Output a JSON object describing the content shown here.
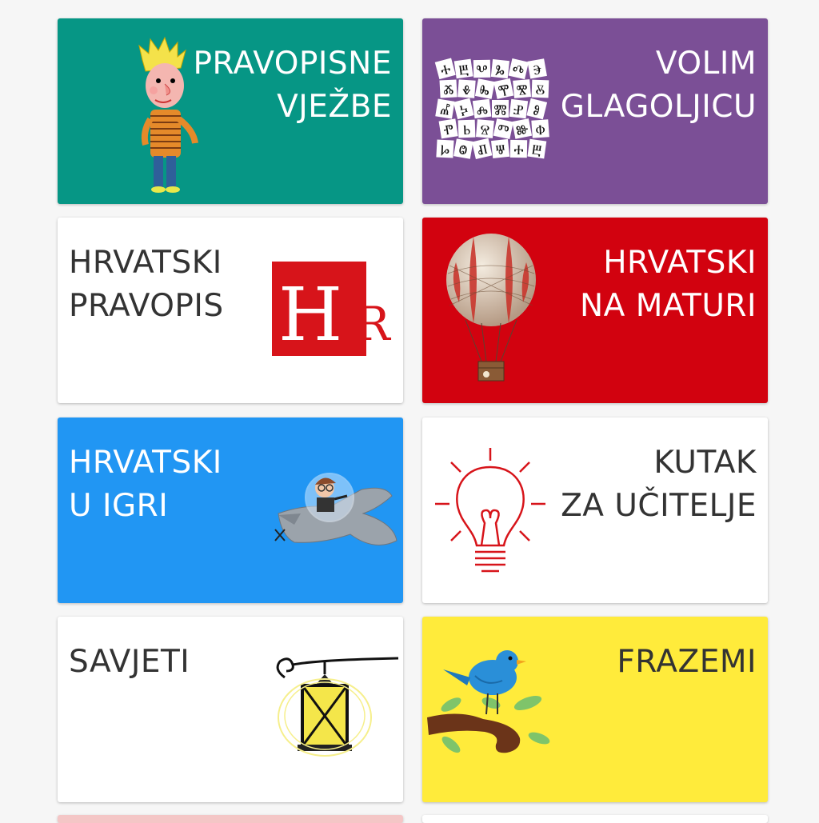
{
  "tiles": [
    {
      "id": "pravopisne-vjezbe",
      "lines": [
        "PRAVOPISNE",
        "VJEŽBE"
      ],
      "bg": "#069685",
      "fg": "#ffffff"
    },
    {
      "id": "volim-glagoljicu",
      "lines": [
        "VOLIM",
        "GLAGOLJICU"
      ],
      "bg": "#7b4f96",
      "fg": "#ffffff"
    },
    {
      "id": "hrvatski-pravopis",
      "lines": [
        "HRVATSKI",
        "PRAVOPIS"
      ],
      "bg": "#ffffff",
      "fg": "#333333",
      "logo": {
        "big": "H",
        "small": "R",
        "color": "#d7141a"
      }
    },
    {
      "id": "hrvatski-na-maturi",
      "lines": [
        "HRVATSKI",
        "NA MATURI"
      ],
      "bg": "#d2020f",
      "fg": "#ffffff"
    },
    {
      "id": "hrvatski-u-igri",
      "lines": [
        "HRVATSKI",
        "U IGRI"
      ],
      "bg": "#2196f3",
      "fg": "#ffffff"
    },
    {
      "id": "kutak-za-ucitelje",
      "lines": [
        "KUTAK",
        "ZA UČITELJE"
      ],
      "bg": "#ffffff",
      "fg": "#333333"
    },
    {
      "id": "savjeti",
      "lines": [
        "SAVJETI"
      ],
      "bg": "#ffffff",
      "fg": "#333333"
    },
    {
      "id": "frazemi",
      "lines": [
        "FRAZEMI"
      ],
      "bg": "#ffeb3b",
      "fg": "#333333"
    }
  ],
  "glagolitic_glyphs": [
    "Ⰰ",
    "Ⰱ",
    "Ⰲ",
    "Ⰳ",
    "Ⰴ",
    "Ⰵ",
    "Ⰶ",
    "Ⰷ",
    "Ⰸ",
    "Ⰹ",
    "Ⰺ",
    "Ⰻ",
    "Ⰼ",
    "Ⰽ",
    "Ⰾ",
    "Ⰿ",
    "Ⱀ",
    "Ⱁ",
    "Ⱂ",
    "Ⱃ",
    "Ⱄ",
    "Ⱅ",
    "Ⱆ",
    "Ⱇ",
    "Ⱈ",
    "Ⱉ",
    "Ⱊ",
    "Ⱋ"
  ]
}
